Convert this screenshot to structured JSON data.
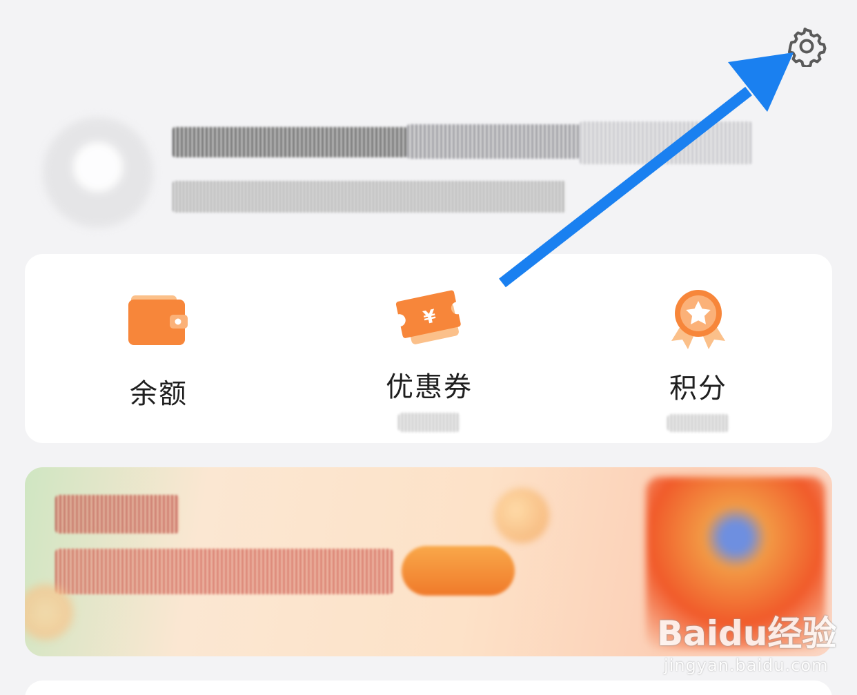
{
  "header": {
    "settings_icon": "gear-icon"
  },
  "profile": {
    "avatar_icon": "user-avatar"
  },
  "assets": {
    "items": [
      {
        "label": "余额",
        "icon": "wallet-icon",
        "color": "#f7863a"
      },
      {
        "label": "优惠券",
        "icon": "coupon-ticket-icon",
        "color": "#f7863a",
        "symbol": "¥"
      },
      {
        "label": "积分",
        "icon": "medal-star-icon",
        "color": "#f7863a"
      }
    ]
  },
  "promo_banner": {
    "colors": {
      "start": "#cfe6c2",
      "mid": "#fde2c8",
      "accent": "#f15a2a"
    }
  },
  "annotation": {
    "arrow_color": "#1a80f0",
    "points_to": "settings-button"
  },
  "watermark": {
    "brand": "Baidu经验",
    "url": "jingyan.baidu.com"
  }
}
